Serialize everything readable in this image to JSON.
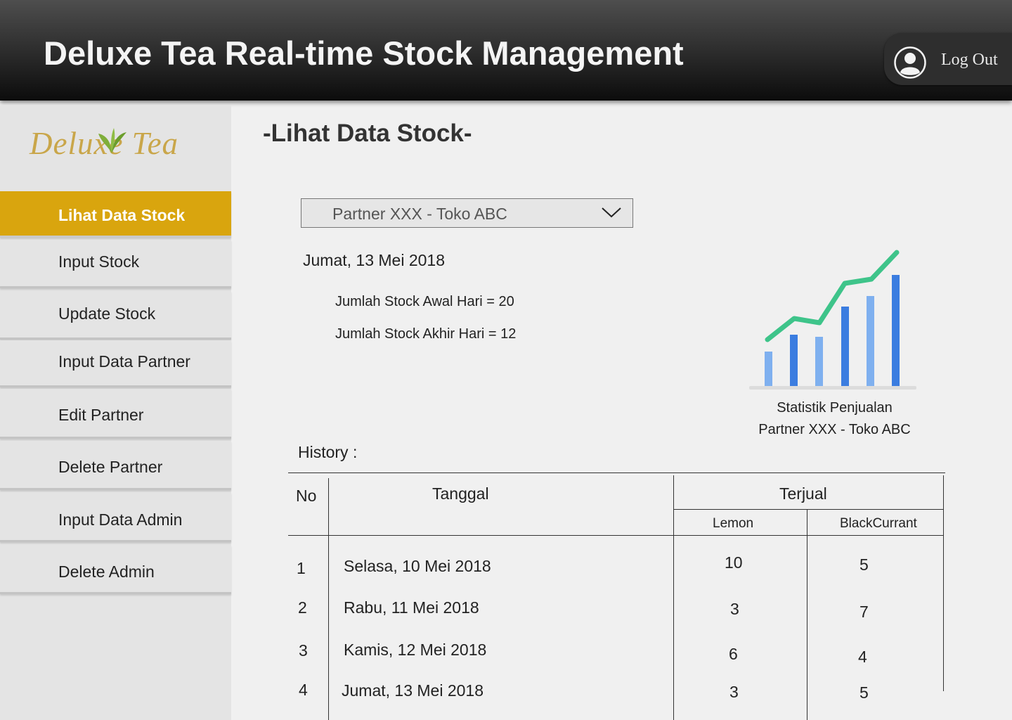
{
  "header": {
    "title": "Deluxe Tea Real-time Stock Management",
    "logout_label": "Log Out"
  },
  "sidebar": {
    "logo_text": "Deluxe Tea",
    "items": [
      {
        "label": "Lihat Data Stock",
        "active": true
      },
      {
        "label": "Input Stock"
      },
      {
        "label": "Update Stock"
      },
      {
        "label": "Input Data Partner"
      },
      {
        "label": "Edit Partner"
      },
      {
        "label": "Delete Partner"
      },
      {
        "label": "Input Data Admin"
      },
      {
        "label": "Delete Admin"
      }
    ]
  },
  "main": {
    "page_title": "-Lihat Data Stock-",
    "partner_select": "Partner XXX - Toko ABC",
    "date": "Jumat, 13 Mei 2018",
    "stock_awal": "Jumlah Stock Awal Hari = 20",
    "stock_akhir": "Jumlah Stock Akhir Hari = 12",
    "chart_caption_line1": "Statistik Penjualan",
    "chart_caption_line2": "Partner XXX - Toko ABC",
    "history_label": "History :"
  },
  "table": {
    "headers": {
      "no": "No",
      "tanggal": "Tanggal",
      "terjual": "Terjual",
      "lemon": "Lemon",
      "blackcurrant": "BlackCurrant"
    },
    "rows": [
      {
        "no": "1",
        "tanggal": "Selasa, 10 Mei 2018",
        "lemon": "10",
        "blackcurrant": "5"
      },
      {
        "no": "2",
        "tanggal": "Rabu, 11 Mei 2018",
        "lemon": "3",
        "blackcurrant": "7"
      },
      {
        "no": "3",
        "tanggal": "Kamis, 12 Mei 2018",
        "lemon": "6",
        "blackcurrant": "4"
      },
      {
        "no": "4",
        "tanggal": "Jumat, 13 Mei 2018",
        "lemon": "3",
        "blackcurrant": "5"
      }
    ]
  },
  "colors": {
    "accent": "#d9a50e",
    "chart_line": "#3ec48a",
    "chart_bar_dark": "#3b7de0",
    "chart_bar_light": "#7fb0ef"
  },
  "icons": {
    "logout": "user-avatar-icon",
    "select": "chevron-down-icon",
    "chart": "sales-chart-icon"
  }
}
